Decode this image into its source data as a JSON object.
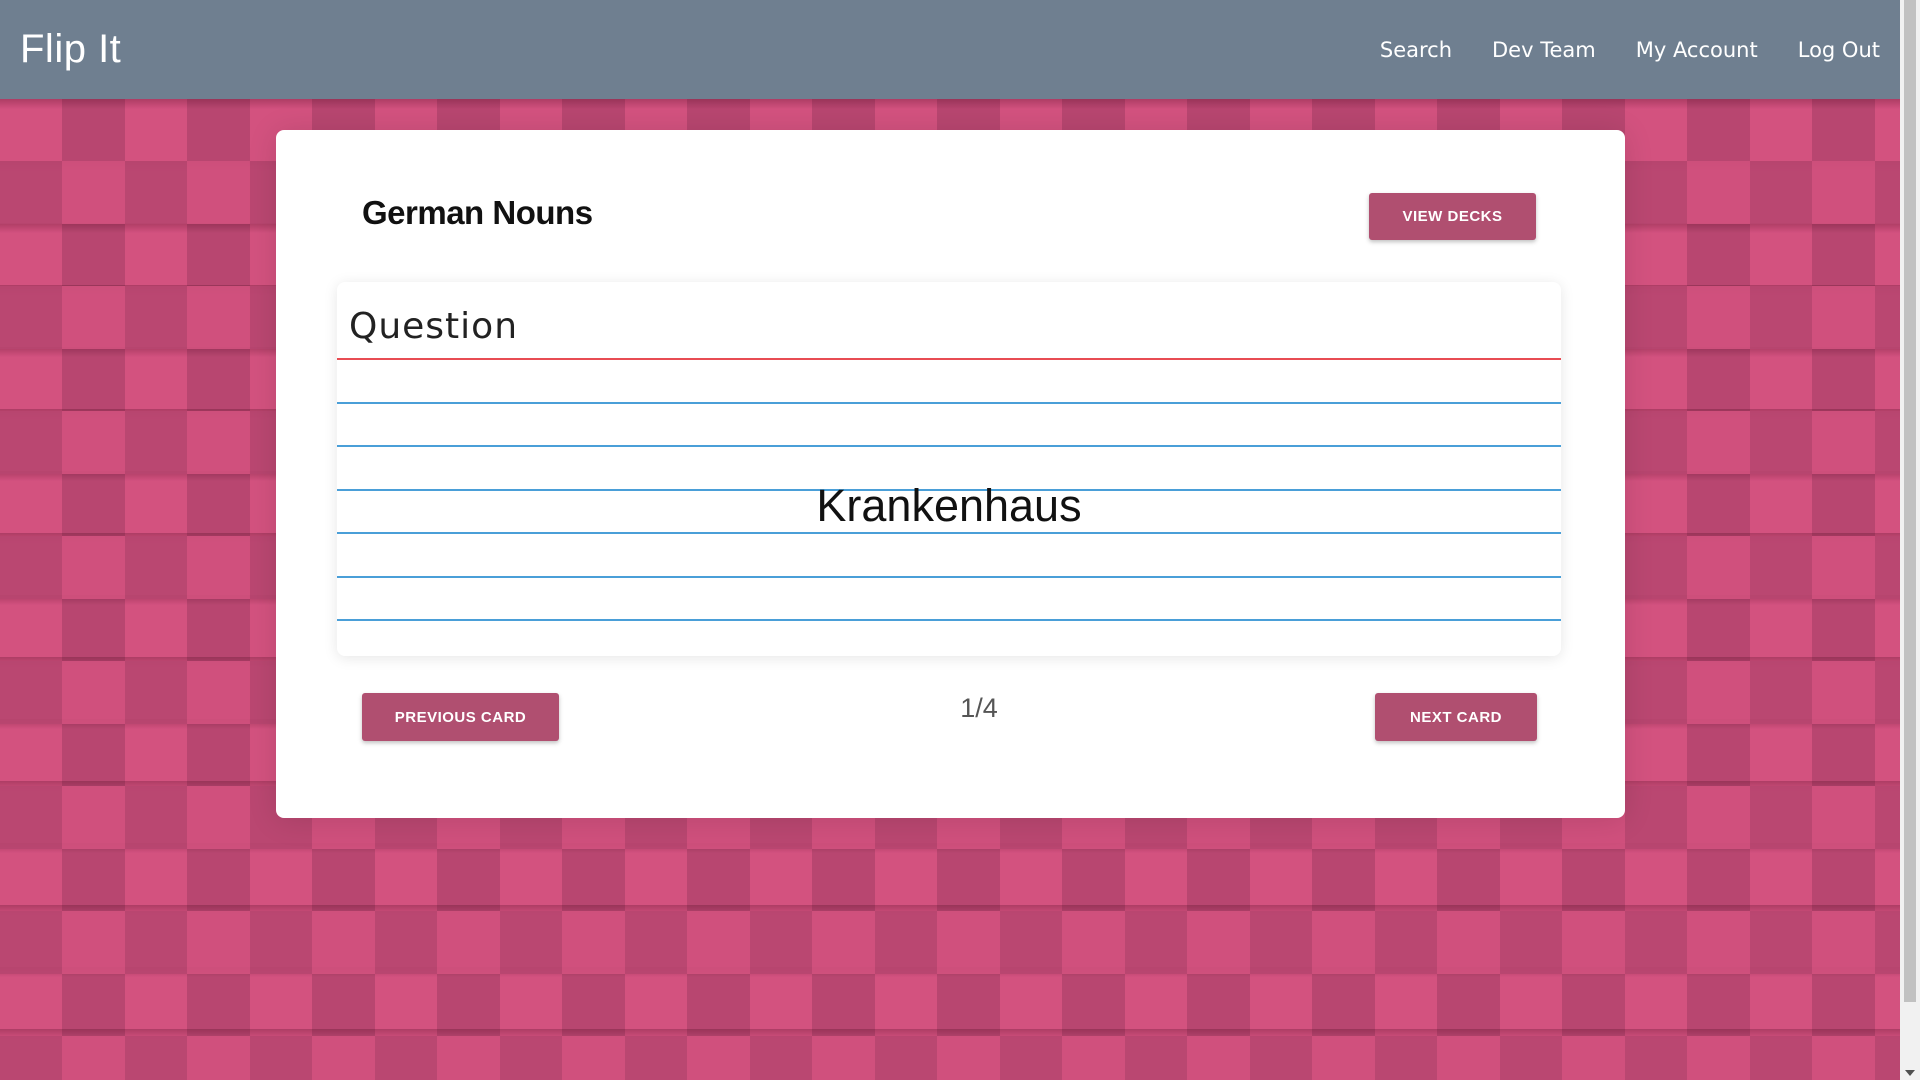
{
  "navbar": {
    "brand": "Flip It",
    "links": [
      {
        "label": "Search"
      },
      {
        "label": "Dev Team"
      },
      {
        "label": "My Account"
      },
      {
        "label": "Log Out"
      }
    ],
    "background_color": "#6f7f90"
  },
  "deck": {
    "title": "German Nouns",
    "view_decks_label": "VIEW DECKS"
  },
  "card": {
    "heading": "Question",
    "content": "Krankenhaus"
  },
  "pagination": {
    "prev_label": "PREVIOUS CARD",
    "next_label": "NEXT CARD",
    "counter": "1/4"
  },
  "colors": {
    "accent": "#b04f70",
    "background_pink": "#c84a77",
    "card_red_rule": "#e84c53",
    "card_blue_rule": "#4a9fd8"
  }
}
